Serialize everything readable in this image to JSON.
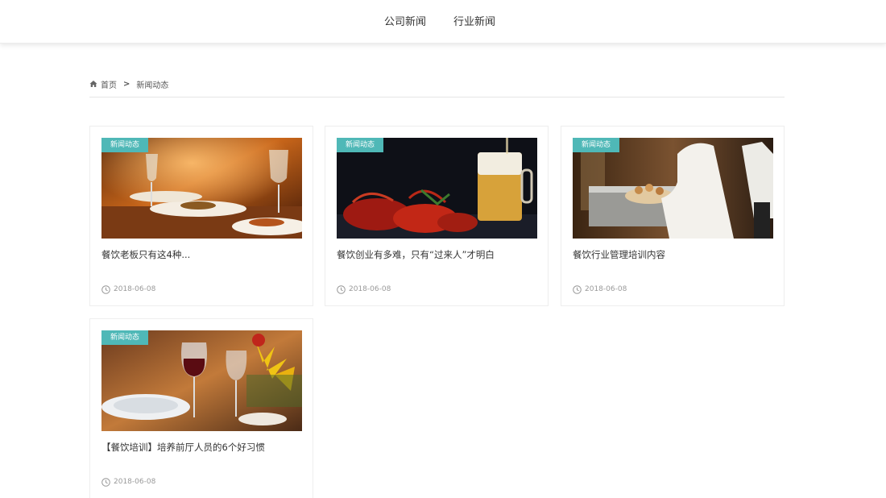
{
  "nav": {
    "items": [
      "公司新闻",
      "行业新闻"
    ]
  },
  "breadcrumb": {
    "home_icon": "home-icon",
    "home": "首页",
    "separator": ">",
    "current": "新闻动态"
  },
  "cards": [
    {
      "tag": "新闻动态",
      "title": "餐饮老板只有这4种...",
      "date": "2018-06-08",
      "image": "restaurant-dining-table-photo"
    },
    {
      "tag": "新闻动态",
      "title": "餐饮创业有多难，只有“过来人”才明白",
      "date": "2018-06-08",
      "image": "crayfish-and-beer-photo"
    },
    {
      "tag": "新闻动态",
      "title": "餐饮行业管理培训内容",
      "date": "2018-06-08",
      "image": "chef-serving-buffet-photo"
    },
    {
      "tag": "新闻动态",
      "title": "【餐饮培训】培养前厅人员的6个好习惯",
      "date": "2018-06-08",
      "image": "wine-glasses-and-flowers-photo"
    }
  ],
  "colors": {
    "tag_bg": "#4fb8b7",
    "date_text": "#999999",
    "title_text": "#333333"
  }
}
